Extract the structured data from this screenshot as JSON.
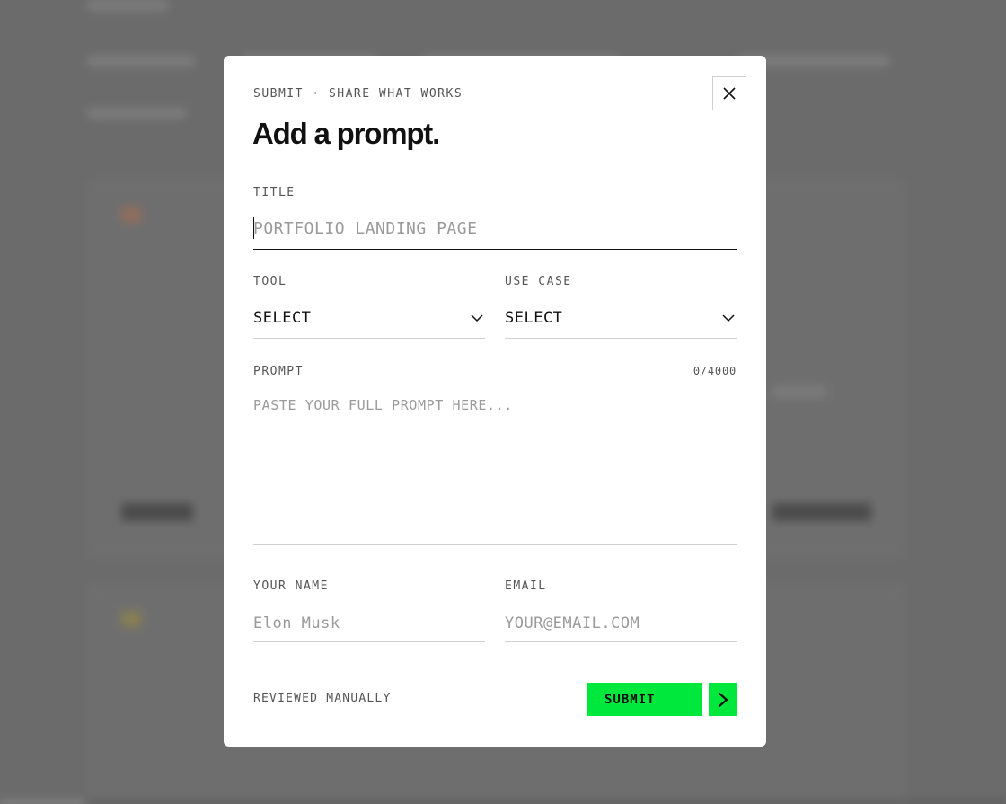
{
  "modal": {
    "eyebrow": "SUBMIT · SHARE WHAT WORKS",
    "title": "Add a prompt.",
    "close_icon": "close-icon"
  },
  "form": {
    "title_label": "TITLE",
    "title_placeholder": "PORTFOLIO LANDING PAGE",
    "title_value": "",
    "tool_label": "TOOL",
    "tool_value": "SELECT",
    "use_case_label": "USE CASE",
    "use_case_value": "SELECT",
    "prompt_label": "PROMPT",
    "prompt_counter": "0/4000",
    "prompt_placeholder": "PASTE YOUR FULL PROMPT HERE...",
    "prompt_value": "",
    "name_label": "YOUR NAME",
    "name_placeholder": "Elon Musk",
    "email_label": "EMAIL",
    "email_placeholder": "YOUR@EMAIL.COM"
  },
  "footer": {
    "note": "REVIEWED MANUALLY",
    "submit_label": "SUBMIT",
    "arrow_icon": "arrow-right-icon"
  },
  "colors": {
    "accent": "#00e83b",
    "overlay": "#6b6b6b",
    "modal_bg": "#ffffff",
    "text": "#111111",
    "muted": "#555555",
    "placeholder": "#9a9a9a"
  }
}
